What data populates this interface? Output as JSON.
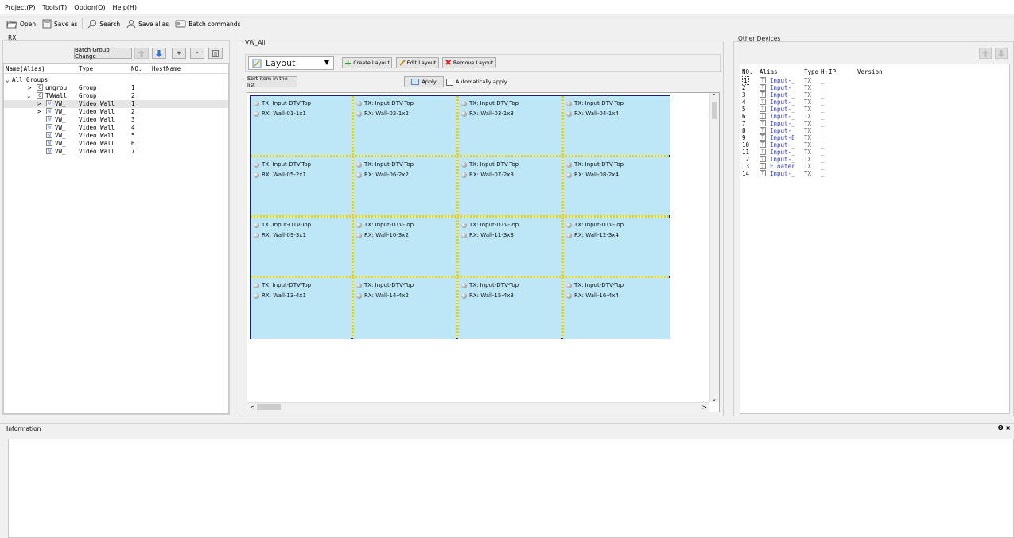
{
  "menu": [
    "Project(P)",
    "Tools(T)",
    "Option(O)",
    "Help(H)"
  ],
  "toolbar": {
    "open": "Open",
    "save_as": "Save as",
    "search": "Search",
    "save_alias": "Save alias",
    "batch": "Batch commands"
  },
  "rx_panel": {
    "title": "RX",
    "batch_group_change": "Batch Group Change",
    "plus": "+",
    "minus": "-",
    "columns": [
      "Name(Alias)",
      "Type",
      "NO.",
      "HostName"
    ],
    "rows": [
      {
        "name": "All Groups",
        "type": "",
        "no": ""
      },
      {
        "name": "ungrou_",
        "type": "Group",
        "no": "1"
      },
      {
        "name": "TVWall",
        "type": "Group",
        "no": "2"
      },
      {
        "name": "VW_",
        "type": "Video Wall",
        "no": "1"
      },
      {
        "name": "VW_",
        "type": "Video Wall",
        "no": "2"
      },
      {
        "name": "VW_",
        "type": "Video Wall",
        "no": "3"
      },
      {
        "name": "VW_",
        "type": "Video Wall",
        "no": "4"
      },
      {
        "name": "VW_",
        "type": "Video Wall",
        "no": "5"
      },
      {
        "name": "VW_",
        "type": "Video Wall",
        "no": "6"
      },
      {
        "name": "VW_",
        "type": "Video Wall",
        "no": "7"
      }
    ],
    "badges": [
      "G",
      "G",
      "W",
      "W",
      "W",
      "W",
      "W",
      "W",
      "W"
    ]
  },
  "center": {
    "title": "VW_All",
    "layout_select": "Layout",
    "create_layout": "Create Layout",
    "edit_layout": "Edit Layout",
    "remove_layout": "Remove Layout",
    "sort_btn": "Sort item in the list",
    "apply": "Apply",
    "auto_apply": "Automatically apply",
    "cells": [
      {
        "tx": "TX: Input-DTV-Top",
        "rx": "RX: Wall-01-1x1"
      },
      {
        "tx": "TX: Input-DTV-Top",
        "rx": "RX: Wall-02-1x2"
      },
      {
        "tx": "TX: Input-DTV-Top",
        "rx": "RX: Wall-03-1x3"
      },
      {
        "tx": "TX: Input-DTV-Top",
        "rx": "RX: Wall-04-1x4"
      },
      {
        "tx": "TX: Input-DTV-Top",
        "rx": "RX: Wall-05-2x1"
      },
      {
        "tx": "TX: Input-DTV-Top",
        "rx": "RX: Wall-06-2x2"
      },
      {
        "tx": "TX: Input-DTV-Top",
        "rx": "RX: Wall-07-2x3"
      },
      {
        "tx": "TX: Input-DTV-Top",
        "rx": "RX: Wall-08-2x4"
      },
      {
        "tx": "TX: Input-DTV-Top",
        "rx": "RX: Wall-09-3x1"
      },
      {
        "tx": "TX: Input-DTV-Top",
        "rx": "RX: Wall-10-3x2"
      },
      {
        "tx": "TX: Input-DTV-Top",
        "rx": "RX: Wall-11-3x3"
      },
      {
        "tx": "TX: Input-DTV-Top",
        "rx": "RX: Wall-12-3x4"
      },
      {
        "tx": "TX: Input-DTV-Top",
        "rx": "RX: Wall-13-4x1"
      },
      {
        "tx": "TX: Input-DTV-Top",
        "rx": "RX: Wall-14-4x2"
      },
      {
        "tx": "TX: Input-DTV-Top",
        "rx": "RX: Wall-15-4x3"
      },
      {
        "tx": "TX: Input-DTV-Top",
        "rx": "RX: Wall-16-4x4"
      }
    ]
  },
  "other": {
    "title": "Other Devices",
    "columns": [
      "NO.",
      "Alias",
      "Type",
      "H:",
      "IP",
      "Version"
    ],
    "rows": [
      {
        "no": "1",
        "alias": "Input-_",
        "type": "TX",
        "h": "_"
      },
      {
        "no": "2",
        "alias": "Input-_",
        "type": "TX",
        "h": "_"
      },
      {
        "no": "3",
        "alias": "Input-_",
        "type": "TX",
        "h": "_"
      },
      {
        "no": "4",
        "alias": "Input-_",
        "type": "TX",
        "h": "_"
      },
      {
        "no": "5",
        "alias": "Input-_",
        "type": "TX",
        "h": "_"
      },
      {
        "no": "6",
        "alias": "Input-_",
        "type": "TX",
        "h": "_"
      },
      {
        "no": "7",
        "alias": "Input-_",
        "type": "TX",
        "h": "_"
      },
      {
        "no": "8",
        "alias": "Input-_",
        "type": "TX",
        "h": "_"
      },
      {
        "no": "9",
        "alias": "Input-8",
        "type": "TX",
        "h": "_"
      },
      {
        "no": "10",
        "alias": "Input-_",
        "type": "TX",
        "h": "_"
      },
      {
        "no": "11",
        "alias": "Input-_",
        "type": "TX",
        "h": "_"
      },
      {
        "no": "12",
        "alias": "Input-_",
        "type": "TX",
        "h": "_"
      },
      {
        "no": "13",
        "alias": "Floater",
        "type": "TX",
        "h": "_"
      },
      {
        "no": "14",
        "alias": "Input-_",
        "type": "TX",
        "h": "_"
      }
    ],
    "badge": "T"
  },
  "info": {
    "title": "Information",
    "controls": "Θ ×"
  }
}
